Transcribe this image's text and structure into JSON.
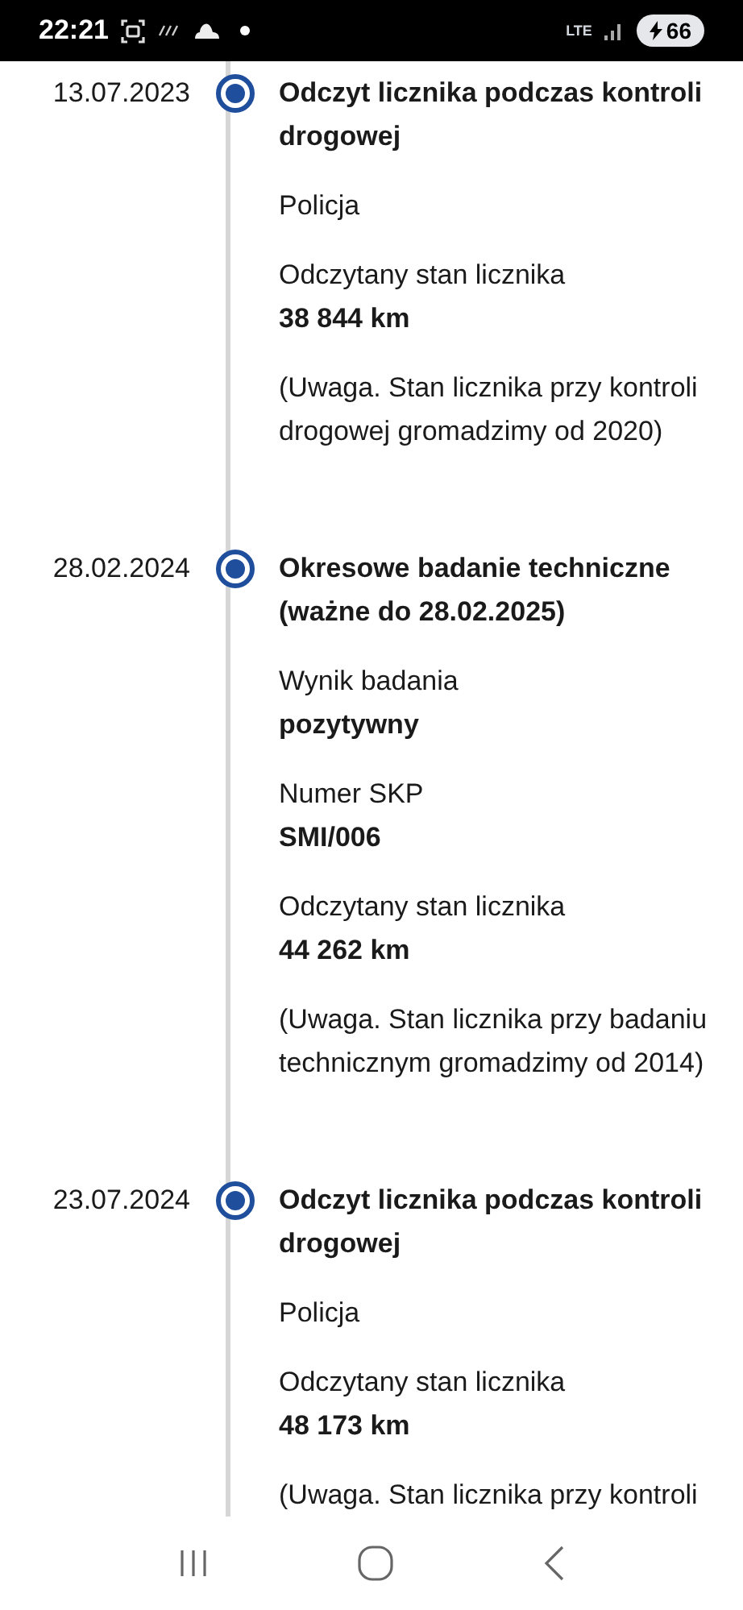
{
  "status_bar": {
    "time": "22:21",
    "network": "LTE",
    "battery": "66"
  },
  "entries": [
    {
      "date": "13.07.2023",
      "title": "Odczyt licznika podczas kontroli drogowej",
      "blocks": [
        {
          "kind": "text",
          "text": "Policja"
        },
        {
          "kind": "field",
          "label": "Odczytany stan licznika",
          "value": "38 844 km"
        },
        {
          "kind": "text",
          "text": "(Uwaga. Stan licznika przy kontroli drogowej gromadzimy od 2020)"
        }
      ]
    },
    {
      "date": "28.02.2024",
      "title": "Okresowe badanie techniczne (ważne do 28.02.2025)",
      "blocks": [
        {
          "kind": "field",
          "label": "Wynik badania",
          "value": "pozytywny"
        },
        {
          "kind": "field",
          "label": "Numer SKP",
          "value": "SMI/006"
        },
        {
          "kind": "field",
          "label": "Odczytany stan licznika",
          "value": "44 262 km"
        },
        {
          "kind": "text",
          "text": "(Uwaga. Stan licznika przy badaniu technicznym gromadzimy od 2014)"
        }
      ]
    },
    {
      "date": "23.07.2024",
      "title": "Odczyt licznika podczas kontroli drogowej",
      "blocks": [
        {
          "kind": "text",
          "text": "Policja"
        },
        {
          "kind": "field",
          "label": "Odczytany stan licznika",
          "value": "48 173 km"
        },
        {
          "kind": "text",
          "text": "(Uwaga. Stan licznika przy kontroli"
        }
      ]
    }
  ]
}
